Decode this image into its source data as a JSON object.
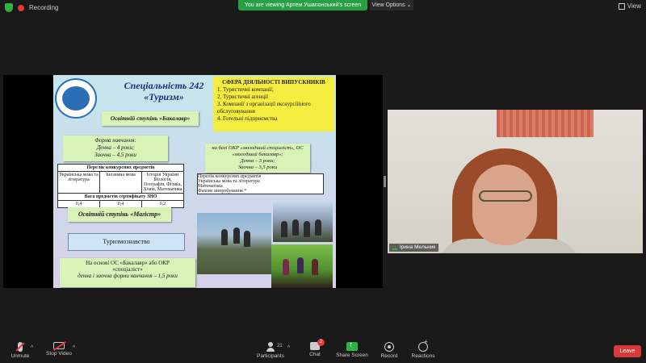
{
  "topbar": {
    "recording": "Recording",
    "viewing_banner": "You are viewing Артем Ушапонський's screen",
    "view_options": "View Options ⌄",
    "view_label": "View"
  },
  "slide": {
    "title_line1": "Спеціальність 242",
    "title_line2": "«Туризм»",
    "sphere_title": "СФЕРА ДІЯЛЬНОСТІ ВИПУСКНИКІВ",
    "sphere_items": [
      "1. Туристичні компанії;",
      "2. Туристичні агенції",
      "3. Компанії з організації екскурсійного обслуговування",
      "4. Готельні підприємства"
    ],
    "bachelor": "Освітній ступінь «Бакалавр»",
    "forma_title": "Форма навчання:",
    "forma_day": "Денна – 4 роки;",
    "forma_extra": "Заочна – 4,5 роки",
    "table1_title": "Перелік конкурсних предметів",
    "table1_cols": [
      "Українська мова та література",
      "Іноземна мова",
      "Історія України Біологія, Географія, Фізика, Хімія, Математика"
    ],
    "table1_subtitle": "Вага предметів сертифікату ЗНО",
    "table1_weights": [
      "0,4",
      "0,4",
      "0,2"
    ],
    "okr_line1": "на базі ОКР «молодший спеціаліст», ОС",
    "okr_line2": "«молодший бакалавр»:",
    "okr_day": "Денна – 3 роки;",
    "okr_extra": "Заочна – 3,5 роки",
    "table2_title": "Перелік конкурсних предметів",
    "table2_cols": [
      "Українська мова та література",
      "Математика",
      "Фахове випробування *"
    ],
    "master": "Освітній ступінь «Магістр»",
    "turism": "Туризмознавство",
    "bazi_line1": "На основі ОС «Бакалавр» або ОКР",
    "bazi_line2": "«спеціаліст»",
    "bazi_line3": "денна і заочна форми навчання – 1,5 роки"
  },
  "video": {
    "name": "Ірина Мельник"
  },
  "controls": {
    "unmute": "Unmute",
    "stop_video": "Stop Video",
    "participants": "Participants",
    "participants_count": "21",
    "chat": "Chat",
    "chat_badge": "2",
    "share_screen": "Share Screen",
    "record": "Record",
    "reactions": "Reactions",
    "leave": "Leave"
  }
}
